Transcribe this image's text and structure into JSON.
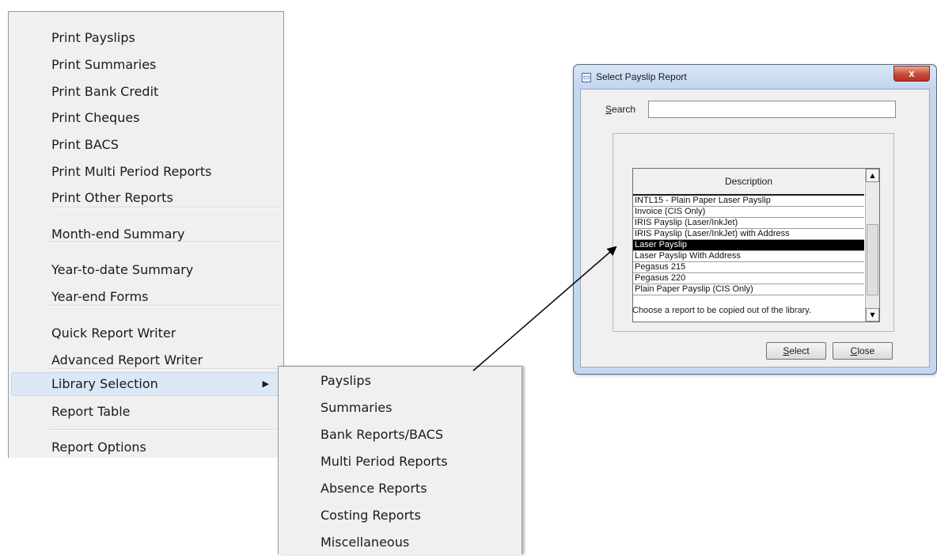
{
  "menu": {
    "items": [
      {
        "label": "Print Payslips"
      },
      {
        "label": "Print Summaries"
      },
      {
        "label": "Print Bank Credit"
      },
      {
        "label": "Print Cheques"
      },
      {
        "label": "Print BACS"
      },
      {
        "label": "Print Multi Period Reports"
      },
      {
        "label": "Print Other Reports"
      },
      {
        "label": "Month-end Summary"
      },
      {
        "label": "Year-to-date Summary"
      },
      {
        "label": "Year-end Forms"
      },
      {
        "label": "Quick Report Writer"
      },
      {
        "label": "Advanced Report Writer"
      },
      {
        "label": "Library Selection",
        "highlighted": true,
        "submenu_arrow": "▶"
      },
      {
        "label": "Report Table"
      },
      {
        "label": "Report Options"
      }
    ]
  },
  "submenu": {
    "items": [
      {
        "label": "Payslips"
      },
      {
        "label": "Summaries"
      },
      {
        "label": "Bank Reports/BACS"
      },
      {
        "label": "Multi Period Reports"
      },
      {
        "label": "Absence Reports"
      },
      {
        "label": "Costing Reports"
      },
      {
        "label": "Miscellaneous"
      }
    ]
  },
  "dialog": {
    "title": "Select Payslip Report",
    "close_glyph": "x",
    "search_label": "Search",
    "search_value": "",
    "column_header": "Description",
    "rows": [
      "INTL15 - Plain Paper Laser Payslip",
      "Invoice (CIS Only)",
      "IRIS Payslip (Laser/InkJet)",
      "IRIS Payslip (Laser/InkJet) with Address",
      "Laser Payslip",
      "Laser Payslip With Address",
      "Pegasus 215",
      "Pegasus 220",
      "Plain Paper Payslip (CIS Only)"
    ],
    "selected_row": "Laser Payslip",
    "hint": "Choose a report to be copied out of the library.",
    "select_button": "Select",
    "close_button": "Close"
  },
  "colors": {
    "menu_bg": "#f0f0f0",
    "menu_highlight": "#dce8f6",
    "dialog_frame": "#c4d7ef",
    "selected_row_bg": "#000000",
    "close_button": "#c9493a"
  }
}
